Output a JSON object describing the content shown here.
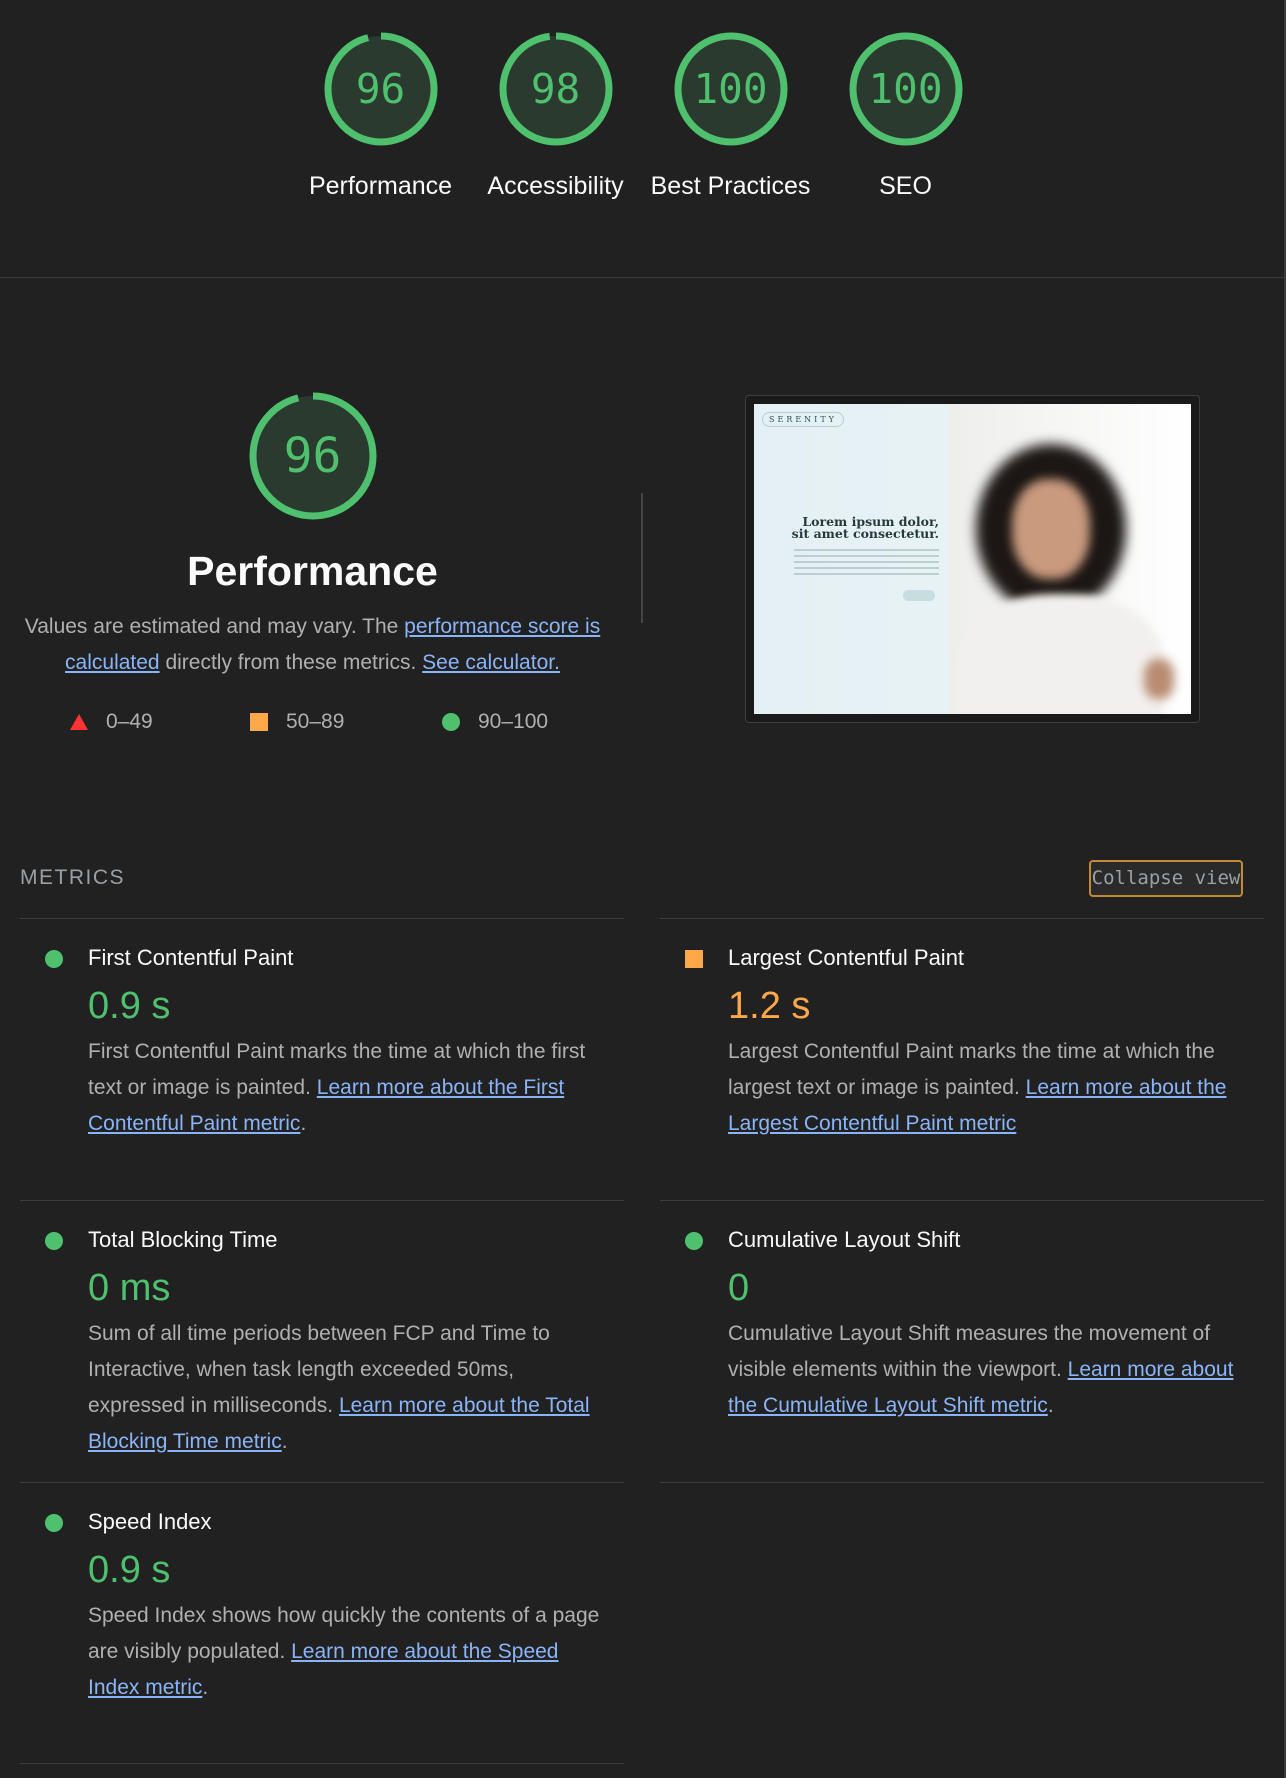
{
  "summary": {
    "gauges": [
      {
        "label": "Performance",
        "score": "96",
        "fraction": 0.96
      },
      {
        "label": "Accessibility",
        "score": "98",
        "fraction": 0.98
      },
      {
        "label": "Best Practices",
        "score": "100",
        "fraction": 1.0
      },
      {
        "label": "SEO",
        "score": "100",
        "fraction": 1.0
      }
    ]
  },
  "performance": {
    "score": "96",
    "fraction": 0.96,
    "title": "Performance",
    "desc_prefix": "Values are estimated and may vary. The ",
    "desc_link1": "performance score is calculated",
    "desc_middle": " directly from these metrics. ",
    "desc_link2": "See calculator.",
    "legend": {
      "fail": "0–49",
      "average": "50–89",
      "pass": "90–100"
    }
  },
  "screenshot": {
    "brand": "SERENITY",
    "headline": "Lorem ipsum dolor, sit amet consectetur."
  },
  "metrics": {
    "header": "METRICS",
    "collapse_label": "Collapse view",
    "fcp": {
      "title": "First Contentful Paint",
      "value": "0.9 s",
      "status": "pass",
      "desc": "First Contentful Paint marks the time at which the first text or image is painted. ",
      "link": "Learn more about the First Contentful Paint metric",
      "tail": "."
    },
    "lcp": {
      "title": "Largest Contentful Paint",
      "value": "1.2 s",
      "status": "average",
      "desc": "Largest Contentful Paint marks the time at which the largest text or image is painted. ",
      "link": "Learn more about the Largest Contentful Paint metric",
      "tail": ""
    },
    "tbt": {
      "title": "Total Blocking Time",
      "value": "0 ms",
      "status": "pass",
      "desc": "Sum of all time periods between FCP and Time to Interactive, when task length exceeded 50ms, expressed in milliseconds. ",
      "link": "Learn more about the Total Blocking Time metric",
      "tail": "."
    },
    "cls": {
      "title": "Cumulative Layout Shift",
      "value": "0",
      "status": "pass",
      "desc": "Cumulative Layout Shift measures the movement of visible elements within the viewport. ",
      "link": "Learn more about the Cumulative Layout Shift metric",
      "tail": "."
    },
    "si": {
      "title": "Speed Index",
      "value": "0.9 s",
      "status": "pass",
      "desc": "Speed Index shows how quickly the contents of a page are visibly populated. ",
      "link": "Learn more about the Speed Index metric",
      "tail": "."
    }
  },
  "colors": {
    "pass": "#4fc16e",
    "average": "#ffa84a",
    "fail": "#ff3333",
    "link": "#8ab4f8"
  }
}
